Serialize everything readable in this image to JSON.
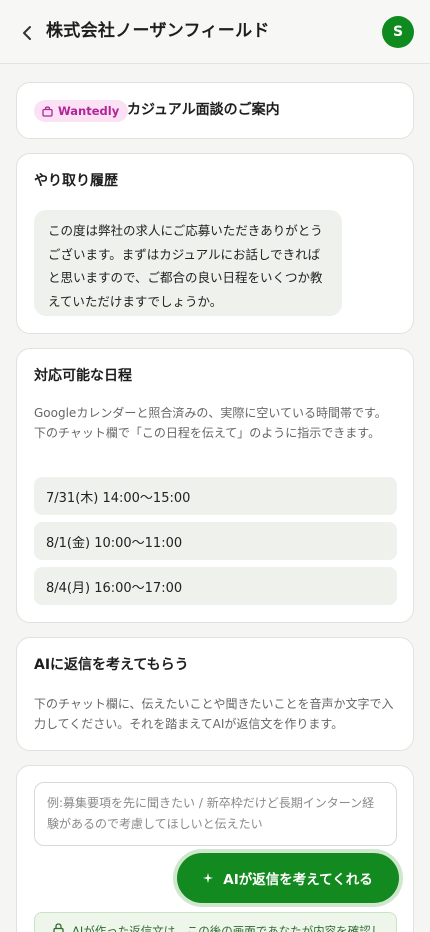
{
  "header": {
    "title": "株式会社ノーザンフィールド",
    "avatar_initial": "S"
  },
  "intro_card": {
    "badge": "Wantedly",
    "title": "カジュアル面談のご案内"
  },
  "history": {
    "heading": "やり取り履歴",
    "message": "この度は弊社の求人にご応募いただきありがとうございます。まずはカジュアルにお話しできればと思いますので、ご都合の良い日程をいくつか教えていただけますでしょうか。"
  },
  "schedule": {
    "heading": "対応可能な日程",
    "description": "Googleカレンダーと照合済みの、実際に空いている時間帯です。下のチャット欄で「この日程を伝えて」のように指示できます。",
    "slots": [
      "7/31(木) 14:00〜15:00",
      "8/1(金) 10:00〜11:00",
      "8/4(月) 16:00〜17:00"
    ]
  },
  "ai_intro": {
    "heading": "AIに返信を考えてもらう",
    "description": "下のチャット欄に、伝えたいことや聞きたいことを音声か文字で入力してください。それを踏まえてAIが返信文を作ります。"
  },
  "composer": {
    "placeholder": "例:募集要項を先に聞きたい / 新卒枠だけど長期インターン経験があるので考慮してほしいと伝えたい",
    "button_label": "AIが返信を考えてくれる",
    "notice": "AIが作った返信文は、この後の画面であなたが内容を確認し"
  },
  "icons": {
    "back": "chevron-left-icon",
    "badge": "bag-icon",
    "sparkle": "sparkle-icon",
    "lock": "lock-icon"
  },
  "colors": {
    "accent": "#138a1f",
    "badge_bg": "#fbe1f4",
    "badge_text": "#b3239a",
    "tile_bg": "#eef1ec"
  }
}
